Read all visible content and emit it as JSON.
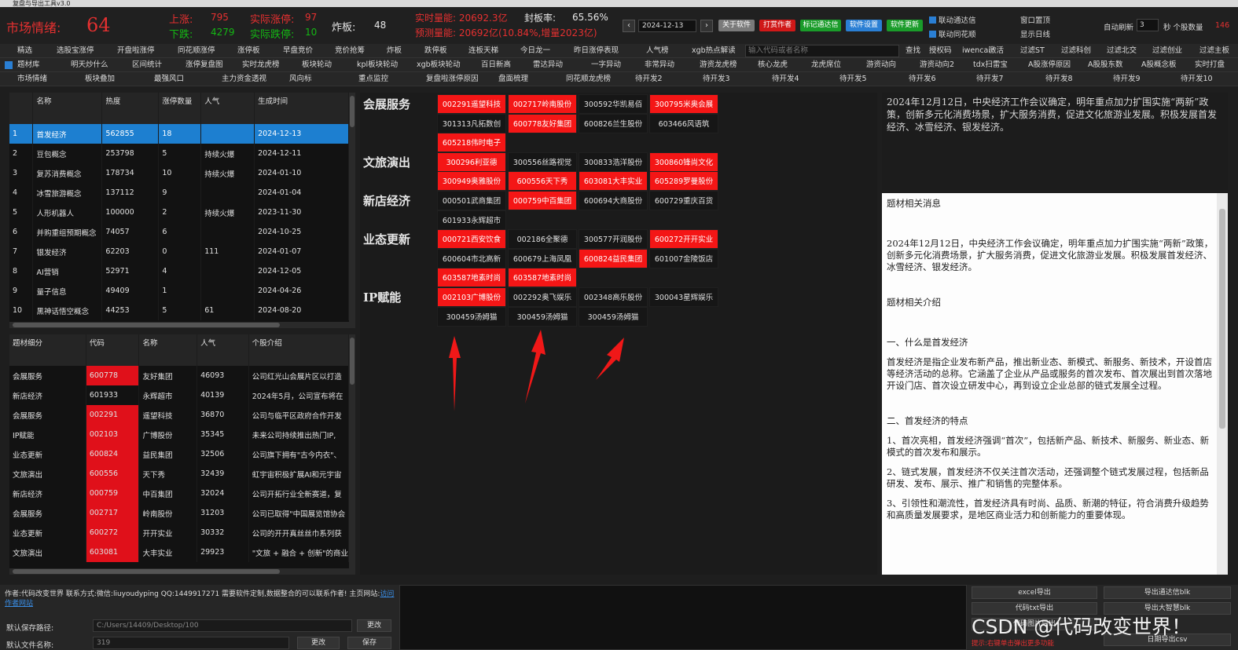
{
  "window": {
    "title": "复盘与导出工具v3.0"
  },
  "stats": {
    "sentiment_label": "市场情绪:",
    "sentiment_value": "64",
    "up_label": "上涨:",
    "up_value": "795",
    "down_label": "下跌:",
    "down_value": "4279",
    "limit_up_label": "实际涨停:",
    "limit_up_value": "97",
    "limit_down_label": "实际跌停:",
    "limit_down_value": "10",
    "broken_label": "炸板:",
    "broken_value": "48",
    "volume_text": "实时量能: 20692.3亿",
    "seal_label": "封板率:",
    "seal_value": "65.56%",
    "forecast_text": "预测量能: 20692亿(10.84%,增量2023亿)",
    "date": "2024-12-13",
    "prev": "‹",
    "next": "›",
    "btn_about": "关于软件",
    "btn_reward": "打赏作者",
    "btn_mark": "标记通达信",
    "btn_settings": "软件设置",
    "btn_update": "软件更新",
    "chk_tdx": "联动通达信",
    "chk_ths": "联动同花顺",
    "win_top": "窗口置顶",
    "show_daily": "显示日线",
    "auto_refresh": "自动刷新",
    "refresh_value": "3",
    "refresh_unit": "秒 个股数量",
    "stock_count": "146"
  },
  "nav1": [
    "精选",
    "选股宝涨停",
    "开盘啦涨停",
    "同花顺涨停",
    "涨停板",
    "早盘竞价",
    "竞价抢筹",
    "炸板",
    "跌停板",
    "连板天梯",
    "今日龙一",
    "昨日涨停表现",
    "人气榜",
    "xgb热点解读"
  ],
  "search": {
    "placeholder": "输入代码或者名称",
    "buttons": [
      "查找",
      "授权码",
      "iwencai",
      "激活"
    ],
    "filters": [
      "过滤ST",
      "过滤科创",
      "过滤北交",
      "过滤创业",
      "过滤主板"
    ]
  },
  "nav2": [
    "题材库",
    "明天炒什么",
    "区间统计",
    "涨停复盘图",
    "实时龙虎榜",
    "板块轮动",
    "kpl板块轮动",
    "xgb板块轮动",
    "百日新高",
    "雷达异动",
    "一字异动",
    "非常异动",
    "游资龙虎榜",
    "核心龙虎",
    "龙虎席位",
    "游资动向",
    "游资动向2",
    "tdx扫雷宝",
    "A股涨停原因",
    "A股股东数",
    "A股概念板",
    "实时打盘"
  ],
  "nav3": [
    "市场情绪",
    "板块叠加",
    "最强风口",
    "主力资金透视",
    "风向标",
    "重点监控",
    "复盘啦涨停原因",
    "盘面梳理",
    "同花顺龙虎榜",
    "待开发2",
    "待开发3",
    "待开发4",
    "待开发5",
    "待开发6",
    "待开发7",
    "待开发8",
    "待开发9",
    "待开发10"
  ],
  "themes": {
    "headers": [
      "",
      "名称",
      "热度",
      "涨停数量",
      "人气",
      "生成时间"
    ],
    "rows": [
      [
        "1",
        "首发经济",
        "562855",
        "18",
        "",
        "2024-12-13"
      ],
      [
        "2",
        "豆包概念",
        "253798",
        "5",
        "持续火爆",
        "2024-12-11"
      ],
      [
        "3",
        "复苏消费概念",
        "178734",
        "10",
        "持续火爆",
        "2024-01-10"
      ],
      [
        "4",
        "冰雪旅游概念",
        "137112",
        "9",
        "",
        "2024-01-04"
      ],
      [
        "5",
        "人形机器人",
        "100000",
        "2",
        "持续火爆",
        "2023-11-30"
      ],
      [
        "6",
        "并购重组预期概念",
        "74057",
        "6",
        "",
        "2024-10-25"
      ],
      [
        "7",
        "银发经济",
        "62203",
        "0",
        "111",
        "2024-01-07"
      ],
      [
        "8",
        "AI营销",
        "52971",
        "4",
        "",
        "2024-12-05"
      ],
      [
        "9",
        "量子信息",
        "49409",
        "1",
        "",
        "2024-04-26"
      ],
      [
        "10",
        "黑神话悟空概念",
        "44253",
        "5",
        "61",
        "2024-08-20"
      ]
    ]
  },
  "subtable": {
    "headers": [
      "题材细分",
      "代码",
      "名称",
      "人气",
      "个股介绍"
    ],
    "rows": [
      [
        "会展服务",
        "600778",
        "友好集团",
        "46093",
        "公司红光山会展片区以打造"
      ],
      [
        "新店经济",
        "601933",
        "永辉超市",
        "40139",
        "2024年5月，公司宣布将在"
      ],
      [
        "会展服务",
        "002291",
        "遥望科技",
        "36870",
        "公司与临平区政府合作开发"
      ],
      [
        "IP赋能",
        "002103",
        "广博股份",
        "35345",
        "未来公司持续推出热门IP,"
      ],
      [
        "业态更新",
        "600824",
        "益民集团",
        "32506",
        "公司旗下拥有\"古今内衣\"、"
      ],
      [
        "文旅演出",
        "600556",
        "天下秀",
        "32439",
        "虹宇宙积极扩展AI和元宇宙"
      ],
      [
        "新店经济",
        "000759",
        "中百集团",
        "32024",
        "公司开拓行业全新赛道，复"
      ],
      [
        "会展服务",
        "002717",
        "岭南股份",
        "31203",
        "公司已取得\"中国展览馆协会"
      ],
      [
        "业态更新",
        "600272",
        "开开实业",
        "30332",
        "公司的开开真丝丝巾系列获"
      ],
      [
        "文旅演出",
        "603081",
        "大丰实业",
        "29923",
        "\"文旅 + 融合 + 创新\"的商业"
      ]
    ]
  },
  "categories": [
    {
      "name": "会展服务",
      "stocks": [
        [
          "002291遥望科技",
          "hot"
        ],
        [
          "002717岭南股份",
          "hot"
        ],
        [
          "300592华凯易佰",
          ""
        ],
        [
          "300795米奥会展",
          "hot"
        ],
        [
          "301313凡拓数创",
          ""
        ],
        [
          "600778友好集团",
          "hot"
        ],
        [
          "600826兰生股份",
          ""
        ],
        [
          "603466风语筑",
          ""
        ],
        [
          "605218伟时电子",
          "hot"
        ]
      ]
    },
    {
      "name": "文旅演出",
      "stocks": [
        [
          "300296利亚德",
          "hot"
        ],
        [
          "300556丝路视觉",
          ""
        ],
        [
          "300833浩洋股份",
          ""
        ],
        [
          "300860锋尚文化",
          "hot"
        ],
        [
          "300949奥雅股份",
          "hot"
        ],
        [
          "600556天下秀",
          "hot"
        ],
        [
          "603081大丰实业",
          "hot"
        ],
        [
          "605289罗曼股份",
          "hot"
        ]
      ]
    },
    {
      "name": "新店经济",
      "stocks": [
        [
          "000501武商集团",
          ""
        ],
        [
          "000759中百集团",
          "hot"
        ],
        [
          "600694大商股份",
          ""
        ],
        [
          "600729重庆百货",
          ""
        ],
        [
          "601933永辉超市",
          ""
        ]
      ]
    },
    {
      "name": "业态更新",
      "stocks": [
        [
          "000721西安饮食",
          "hot"
        ],
        [
          "002186全聚德",
          ""
        ],
        [
          "300577开润股份",
          ""
        ],
        [
          "600272开开实业",
          "hot"
        ],
        [
          "600604市北高新",
          ""
        ],
        [
          "600679上海凤凰",
          ""
        ],
        [
          "600824益民集团",
          "hot"
        ],
        [
          "601007金陵饭店",
          ""
        ],
        [
          "603587地素时尚",
          "hot"
        ],
        [
          "603587地素时尚",
          "hot"
        ]
      ]
    },
    {
      "name": "IP赋能",
      "stocks": [
        [
          "002103广博股份",
          "hot"
        ],
        [
          "002292奥飞娱乐",
          ""
        ],
        [
          "002348高乐股份",
          ""
        ],
        [
          "300043星辉娱乐",
          ""
        ],
        [
          "300459汤姆猫",
          ""
        ],
        [
          "300459汤姆猫",
          ""
        ],
        [
          "300459汤姆猫",
          ""
        ]
      ]
    }
  ],
  "summary": "2024年12月12日，中央经济工作会议确定，明年重点加力扩围实施“两新”政策，创新多元化消费场景，扩大服务消费，促进文化旅游业发展。积极发展首发经济、冰雪经济、银发经济。",
  "news": {
    "title": "题材相关消息",
    "body": "2024年12月12日，中央经济工作会议确定，明年重点加力扩围实施“两新”政策，创新多元化消费场景，扩大服务消费，促进文化旅游业发展。积极发展首发经济、冰雪经济、银发经济。",
    "intro_title": "题材相关介绍",
    "h1": "一、什么是首发经济",
    "p1": "首发经济是指企业发布新产品，推出新业态、新模式、新服务、新技术，开设首店等经济活动的总称。它涵盖了企业从产品或服务的首次发布、首次展出到首次落地开设门店、首次设立研发中心，再到设立企业总部的链式发展全过程。",
    "h2": "二、首发经济的特点",
    "p2": "1、首次亮相，首发经济强调“首次”，包括新产品、新技术、新服务、新业态、新模式的首次发布和展示。",
    "p3": "2、链式发展，首发经济不仅关注首次活动，还强调整个链式发展过程，包括新品研发、发布、展示、推广和销售的完整体系。",
    "p4": "3、引领性和潮流性，首发经济具有时尚、品质、新潮的特征，符合消费升级趋势和高质量发展要求，是地区商业活力和创新能力的重要体现。"
  },
  "bottom": {
    "author": "作者:代码改变世界 联系方式:微信:liuyoudyping QQ:1449917271 需要软件定制,数据整合的可以联系作者! 主页网站:",
    "site_link": "访问作者网站",
    "save_path_label": "默认保存路径:",
    "save_path": "C:/Users/14409/Desktop/100",
    "change": "更改",
    "file_label": "默认文件名称:",
    "file_name": "319",
    "change2": "更改",
    "save": "保存",
    "export_btns": [
      "excel导出",
      "导出通达信blk",
      "代码txt导出",
      "导出大智慧blk",
      "代码图片导出",
      "日期导出csv"
    ],
    "hint": "提示:右键单击弹出更多功能",
    "watermark": "CSDN @代码改变世界！"
  }
}
